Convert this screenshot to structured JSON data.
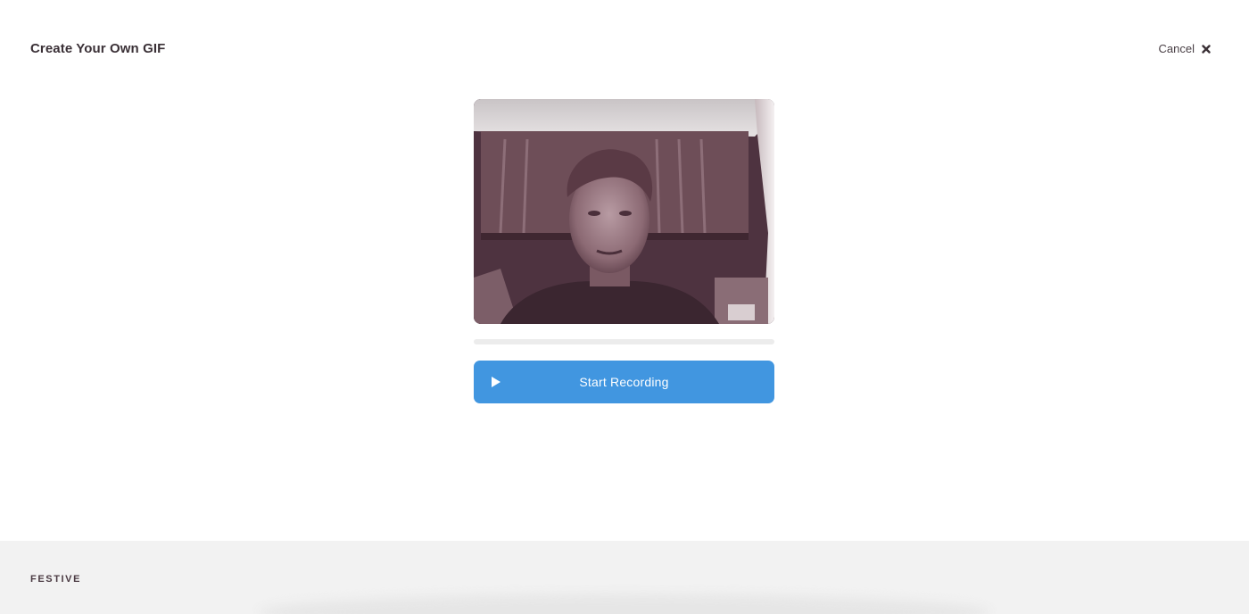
{
  "header": {
    "title": "Create Your Own GIF",
    "cancel_label": "Cancel"
  },
  "recorder": {
    "progress": 0,
    "button_label": "Start Recording"
  },
  "footer": {
    "logo_text": "FESTIVE"
  },
  "colors": {
    "accent": "#4196e0",
    "title_text": "#3a3036",
    "footer_bg": "#f2f2f2"
  },
  "icons": {
    "close": "close-icon",
    "play": "play-icon"
  }
}
